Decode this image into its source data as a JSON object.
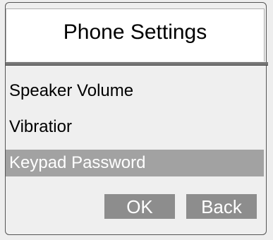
{
  "header": {
    "title": "Phone Settings"
  },
  "menu": {
    "items": [
      {
        "label": "Speaker Volume",
        "selected": false
      },
      {
        "label": "Vibratior",
        "selected": false
      },
      {
        "label": "Keypad Password",
        "selected": true
      }
    ]
  },
  "buttons": {
    "ok_label": "OK",
    "back_label": "Back"
  },
  "colors": {
    "selection": "#a2a2a2",
    "button": "#8d8d8d",
    "divider": "#767676"
  }
}
